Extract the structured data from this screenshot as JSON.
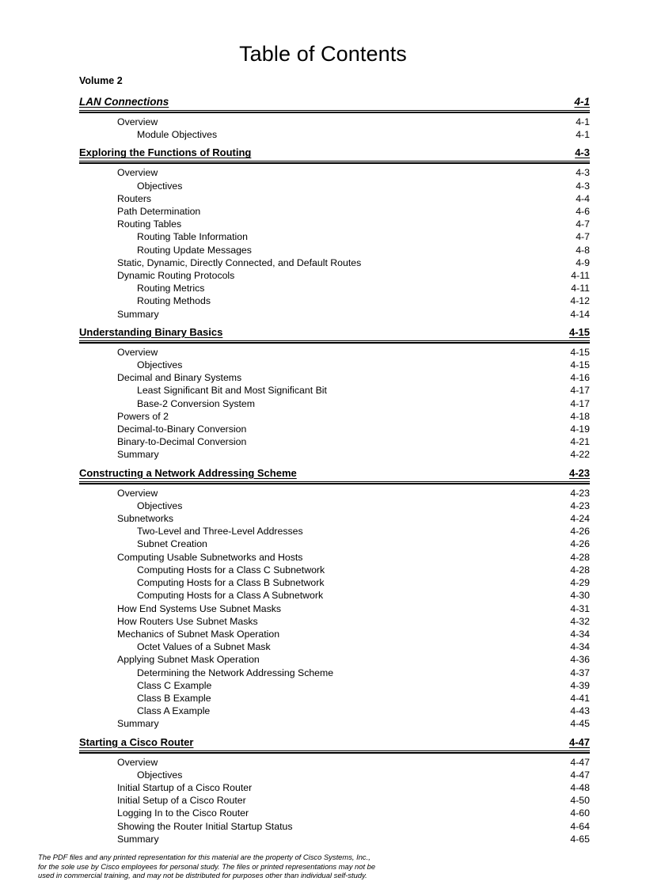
{
  "document": {
    "title": "Table of Contents",
    "volume_label": "Volume 2"
  },
  "module": {
    "heading": "LAN Connections",
    "page": "4-1",
    "entries": [
      {
        "level": 1,
        "label": "Overview",
        "page": "4-1"
      },
      {
        "level": 2,
        "label": "Module Objectives",
        "page": "4-1"
      }
    ]
  },
  "sections": [
    {
      "heading": "Exploring the Functions of Routing",
      "page": "4-3",
      "entries": [
        {
          "level": 1,
          "label": "Overview",
          "page": "4-3"
        },
        {
          "level": 2,
          "label": "Objectives",
          "page": "4-3"
        },
        {
          "level": 1,
          "label": "Routers",
          "page": "4-4"
        },
        {
          "level": 1,
          "label": "Path Determination",
          "page": "4-6"
        },
        {
          "level": 1,
          "label": "Routing Tables",
          "page": "4-7"
        },
        {
          "level": 2,
          "label": "Routing Table Information",
          "page": "4-7"
        },
        {
          "level": 2,
          "label": "Routing Update Messages",
          "page": "4-8"
        },
        {
          "level": 1,
          "label": "Static, Dynamic, Directly Connected, and Default Routes",
          "page": "4-9"
        },
        {
          "level": 1,
          "label": "Dynamic Routing Protocols",
          "page": "4-11"
        },
        {
          "level": 2,
          "label": "Routing Metrics",
          "page": "4-11"
        },
        {
          "level": 2,
          "label": "Routing Methods",
          "page": "4-12"
        },
        {
          "level": 1,
          "label": "Summary",
          "page": "4-14"
        }
      ]
    },
    {
      "heading": "Understanding Binary Basics",
      "page": "4-15",
      "entries": [
        {
          "level": 1,
          "label": "Overview",
          "page": "4-15"
        },
        {
          "level": 2,
          "label": "Objectives",
          "page": "4-15"
        },
        {
          "level": 1,
          "label": "Decimal and Binary Systems",
          "page": "4-16"
        },
        {
          "level": 2,
          "label": "Least Significant Bit and Most Significant Bit",
          "page": "4-17"
        },
        {
          "level": 2,
          "label": "Base-2 Conversion System",
          "page": "4-17"
        },
        {
          "level": 1,
          "label": "Powers of 2",
          "page": "4-18"
        },
        {
          "level": 1,
          "label": "Decimal-to-Binary Conversion",
          "page": "4-19"
        },
        {
          "level": 1,
          "label": "Binary-to-Decimal Conversion",
          "page": "4-21"
        },
        {
          "level": 1,
          "label": "Summary",
          "page": "4-22"
        }
      ]
    },
    {
      "heading": "Constructing a Network Addressing Scheme",
      "page": "4-23",
      "entries": [
        {
          "level": 1,
          "label": "Overview",
          "page": "4-23"
        },
        {
          "level": 2,
          "label": "Objectives",
          "page": "4-23"
        },
        {
          "level": 1,
          "label": "Subnetworks",
          "page": "4-24"
        },
        {
          "level": 2,
          "label": "Two-Level and Three-Level Addresses",
          "page": "4-26"
        },
        {
          "level": 2,
          "label": "Subnet Creation",
          "page": "4-26"
        },
        {
          "level": 1,
          "label": "Computing Usable Subnetworks and Hosts",
          "page": "4-28"
        },
        {
          "level": 2,
          "label": "Computing Hosts for a Class C Subnetwork",
          "page": "4-28"
        },
        {
          "level": 2,
          "label": "Computing Hosts for a Class B Subnetwork",
          "page": "4-29"
        },
        {
          "level": 2,
          "label": "Computing Hosts for a Class A Subnetwork",
          "page": "4-30"
        },
        {
          "level": 1,
          "label": "How End Systems Use Subnet Masks",
          "page": "4-31"
        },
        {
          "level": 1,
          "label": "How Routers Use Subnet Masks",
          "page": "4-32"
        },
        {
          "level": 1,
          "label": "Mechanics of Subnet Mask Operation",
          "page": "4-34"
        },
        {
          "level": 2,
          "label": "Octet Values of a Subnet Mask",
          "page": "4-34"
        },
        {
          "level": 1,
          "label": "Applying Subnet Mask Operation",
          "page": "4-36"
        },
        {
          "level": 2,
          "label": "Determining the Network Addressing Scheme",
          "page": "4-37"
        },
        {
          "level": 2,
          "label": "Class C Example",
          "page": "4-39"
        },
        {
          "level": 2,
          "label": "Class B Example",
          "page": "4-41"
        },
        {
          "level": 2,
          "label": "Class A Example",
          "page": "4-43"
        },
        {
          "level": 1,
          "label": "Summary",
          "page": "4-45"
        }
      ]
    },
    {
      "heading": "Starting a Cisco Router",
      "page": "4-47",
      "entries": [
        {
          "level": 1,
          "label": "Overview",
          "page": "4-47"
        },
        {
          "level": 2,
          "label": "Objectives",
          "page": "4-47"
        },
        {
          "level": 1,
          "label": "Initial Startup of a Cisco Router",
          "page": "4-48"
        },
        {
          "level": 1,
          "label": "Initial Setup of a Cisco Router",
          "page": "4-50"
        },
        {
          "level": 1,
          "label": "Logging In to the Cisco Router",
          "page": "4-60"
        },
        {
          "level": 1,
          "label": "Showing the Router Initial Startup Status",
          "page": "4-64"
        },
        {
          "level": 1,
          "label": "Summary",
          "page": "4-65"
        }
      ]
    }
  ],
  "footer": {
    "line1": "The PDF files and any printed representation for this material are the property of Cisco Systems, Inc.,",
    "line2": "for the sole use by Cisco employees for personal study. The files or printed representations may not be",
    "line3": "used in commercial training, and may not be distributed for purposes other than individual self-study."
  }
}
